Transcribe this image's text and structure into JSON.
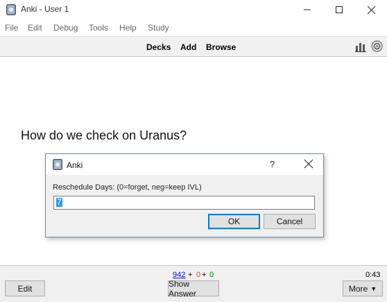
{
  "window": {
    "title": "Anki - User 1"
  },
  "menu": {
    "file": "File",
    "edit": "Edit",
    "debug": "Debug",
    "tools": "Tools",
    "help": "Help",
    "study": "Study"
  },
  "toolbar": {
    "decks": "Decks",
    "add": "Add",
    "browse": "Browse",
    "icons": [
      "stats-icon",
      "sync-icon"
    ]
  },
  "card": {
    "question": "How do we check on Uranus?"
  },
  "dialog": {
    "title": "Anki",
    "help": "?",
    "label": "Reschedule Days: (0=forget, neg=keep IVL)",
    "input_value": "7",
    "ok": "OK",
    "cancel": "Cancel"
  },
  "bottombar": {
    "counts": {
      "new": "942",
      "plus1": "+",
      "learn": "0",
      "plus2": "+",
      "review": "0"
    },
    "timer": "0:43",
    "edit": "Edit",
    "show_answer": "Show Answer",
    "more": "More"
  },
  "colors": {
    "accent_blue": "#0078d7",
    "new_count": "#0000ff",
    "learn_count": "#c35617",
    "review_count": "#007700",
    "selection": "#3399ff"
  }
}
